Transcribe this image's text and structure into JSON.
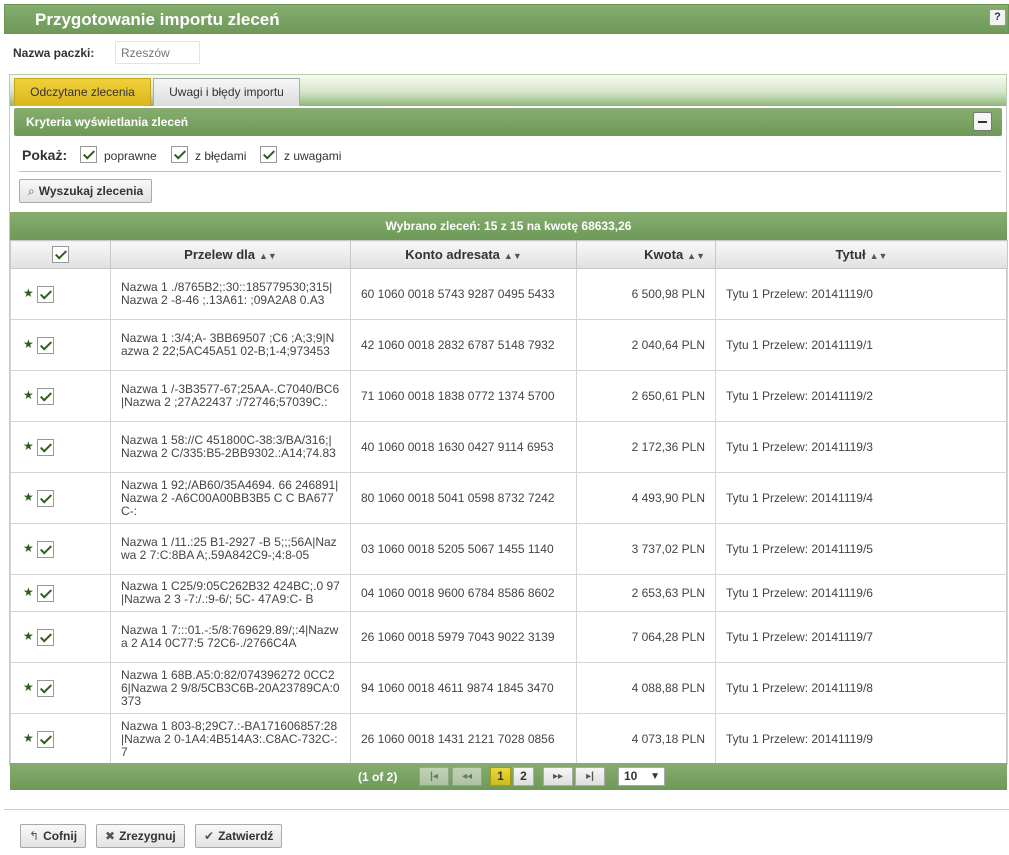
{
  "header": {
    "title": "Przygotowanie importu zleceń",
    "help_label": "?"
  },
  "package": {
    "label": "Nazwa paczki:",
    "placeholder": "Rzeszów"
  },
  "tabs": [
    {
      "label": "Odczytane zlecenia",
      "active": true
    },
    {
      "label": "Uwagi i błędy importu",
      "active": false
    }
  ],
  "criteria": {
    "title": "Kryteria wyświetlania zleceń",
    "show_label": "Pokaż:",
    "options": [
      {
        "label": "poprawne",
        "checked": true
      },
      {
        "label": "z błędami",
        "checked": true
      },
      {
        "label": "z uwagami",
        "checked": true
      }
    ],
    "search_button": "Wyszukaj zlecenia"
  },
  "summary": "Wybrano zleceń: 15 z 15 na kwotę 68633,26",
  "table": {
    "columns": [
      "Przelew dla",
      "Konto adresata",
      "Kwota",
      "Tytuł"
    ],
    "rows": [
      {
        "name": "Nazwa 1 ./8765B2;:30::185779530;315|Nazwa 2 -8-46 ;.13A61: ;09A2A8 0.A3",
        "account": "60 1060 0018 5743 9287 0495 5433",
        "amount": "6 500,98 PLN",
        "title": "Tytu 1 Przelew: 20141119/0"
      },
      {
        "name": "Nazwa 1 :3/4;A- 3BB69507 ;C6 ;A;3;9|Nazwa 2 22;5AC45A51 02-B;1-4;973453",
        "account": "42 1060 0018 2832 6787 5148 7932",
        "amount": "2 040,64 PLN",
        "title": "Tytu 1 Przelew: 20141119/1"
      },
      {
        "name": "Nazwa 1 /-3B3577-67;25AA-.C7040/BC6|Nazwa 2 ;27A22437 :/72746;57039C.:",
        "account": "71 1060 0018 1838 0772 1374 5700",
        "amount": "2 650,61 PLN",
        "title": "Tytu 1 Przelew: 20141119/2"
      },
      {
        "name": "Nazwa 1 58://C 451800C-38:3/BA/316;|Nazwa 2 C/335:B5-2BB9302.:A14;74.83",
        "account": "40 1060 0018 1630 0427 9114 6953",
        "amount": "2 172,36 PLN",
        "title": "Tytu 1 Przelew: 20141119/3"
      },
      {
        "name": "Nazwa 1 92;/AB60/35A4694. 66 246891|Nazwa 2 -A6C00A00BB3B5 C C BA677C-:",
        "account": "80 1060 0018 5041 0598 8732 7242",
        "amount": "4 493,90 PLN",
        "title": "Tytu 1 Przelew: 20141119/4"
      },
      {
        "name": "Nazwa 1 /11.:25 B1-2927 -B 5;;;56A|Nazwa 2 7:C:8BA A;.59A842C9-;4:8-05",
        "account": "03 1060 0018 5205 5067 1455 1140",
        "amount": "3 737,02 PLN",
        "title": "Tytu 1 Przelew: 20141119/5"
      },
      {
        "name": "Nazwa 1 C25/9:05C262B32 424BC;.0 97|Nazwa 2 3 -7:/.:9-6/; 5C- 47A9:C- B",
        "account": "04 1060 0018 9600 6784 8586 8602",
        "amount": "2 653,63 PLN",
        "title": "Tytu 1 Przelew: 20141119/6"
      },
      {
        "name": "Nazwa 1 7:::01.-:5/8:769629.89/;:4|Nazwa 2 A14 0C77:5 72C6-./2766C4A",
        "account": "26 1060 0018 5979 7043 9022 3139",
        "amount": "7 064,28 PLN",
        "title": "Tytu 1 Przelew: 20141119/7"
      },
      {
        "name": "Nazwa 1 68B.A5:0:82/074396272 0CC26|Nazwa 2 9/8/5CB3C6B-20A23789CA:0373",
        "account": "94 1060 0018 4611 9874 1845 3470",
        "amount": "4 088,88 PLN",
        "title": "Tytu 1 Przelew: 20141119/8"
      },
      {
        "name": "Nazwa 1 803-8;29C7.:-BA171606857:28|Nazwa 2 0-1A4:4B514A3:.C8AC-732C-:7",
        "account": "26 1060 0018 1431 2121 7028 0856",
        "amount": "4 073,18 PLN",
        "title": "Tytu 1 Przelew: 20141119/9"
      }
    ]
  },
  "pager": {
    "info": "(1 of 2)",
    "pages": [
      "1",
      "2"
    ],
    "current": "1",
    "rows_per_page": "10",
    "first_label": "|◂",
    "prev_label": "◂◂",
    "next_label": "▸▸",
    "last_label": "▸|"
  },
  "footer": {
    "back_button": "Cofnij",
    "cancel_button": "Zrezygnuj",
    "confirm_button": "Zatwierdź"
  }
}
